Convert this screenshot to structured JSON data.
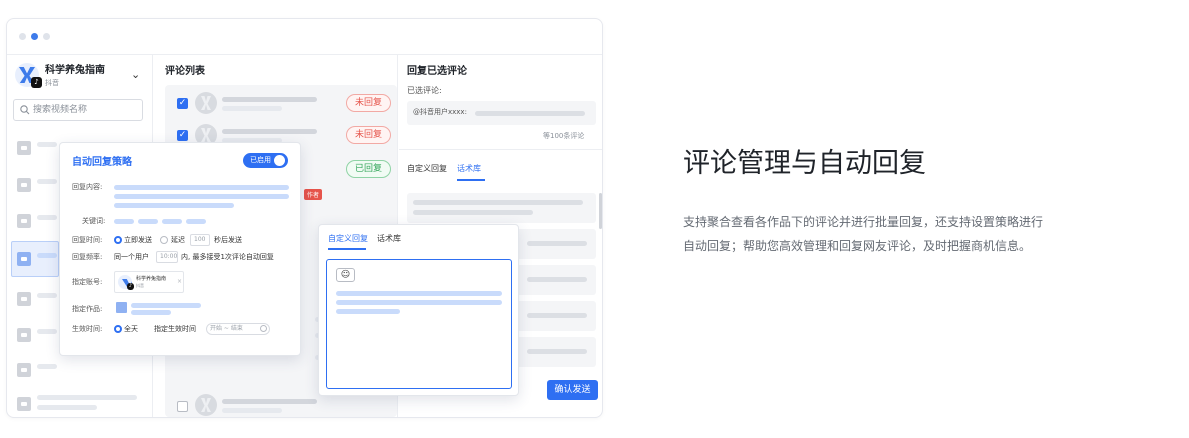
{
  "window": {
    "account": {
      "name": "科学养兔指南",
      "platform": "抖音"
    },
    "search": {
      "placeholder": "搜索视频名称"
    },
    "comment_list": {
      "title": "评论列表",
      "status_unreplied": "未回复",
      "status_replied": "已回复",
      "author_badge": "作者"
    },
    "reply_panel": {
      "title": "回复已选评论",
      "selected_label": "已选评论:",
      "selected_user": "@抖音用户xxxx:",
      "count_text": "等100条评论",
      "tabs": [
        "自定义回复",
        "话术库"
      ],
      "confirm_button": "确认发送"
    },
    "auto_reply": {
      "title": "自动回复策略",
      "toggle_label": "已启用",
      "content_label": "回复内容:",
      "keyword_label": "关键词:",
      "time_label": "回复时间:",
      "time_option_immediate": "立即发送",
      "time_option_delay": "延迟",
      "delay_value": "100",
      "delay_unit": "秒后发送",
      "freq_label": "回复频率:",
      "freq_prefix": "同一个用户",
      "freq_value": "10:00",
      "freq_suffix": "内, 最多接受1次评论自动回复",
      "account_label": "指定账号:",
      "account_name": "科学养兔指南",
      "account_platform": "抖音",
      "works_label": "指定作品:",
      "effective_label": "生效时间:",
      "effective_all": "全天",
      "effective_custom": "指定生效时间",
      "effective_placeholder": "开始 ~ 结束"
    },
    "popup": {
      "tabs": [
        "自定义回复",
        "话术库"
      ],
      "emoji": "☺"
    }
  },
  "feature": {
    "title": "评论管理与自动回复",
    "description_line1": "支持聚合查看各作品下的评论并进行批量回复，还支持设置策略进行",
    "description_line2": "自动回复；帮助您高效管理和回复网友评论，及时把握商机信息。"
  },
  "colors": {
    "accent": "#2e6ff2",
    "unreplied": "#e6544b",
    "replied": "#33a55a"
  }
}
